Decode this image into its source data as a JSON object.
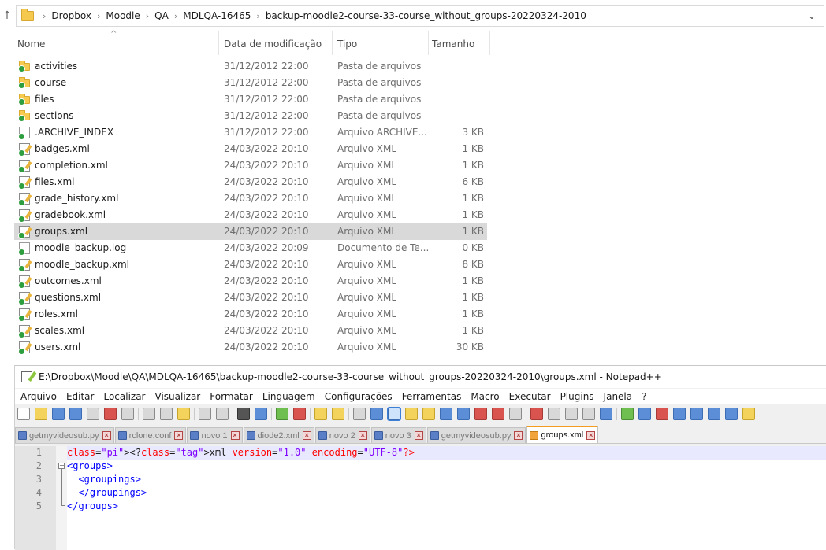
{
  "explorer": {
    "breadcrumb": [
      "Dropbox",
      "Moodle",
      "QA",
      "MDLQA-16465",
      "backup-moodle2-course-33-course_without_groups-20220324-2010"
    ],
    "columns": {
      "name": "Nome",
      "date": "Data de modificação",
      "type": "Tipo",
      "size": "Tamanho"
    },
    "files": [
      {
        "name": "activities",
        "date": "31/12/2012 22:00",
        "type": "Pasta de arquivos",
        "size": "",
        "icon": "folder-icon"
      },
      {
        "name": "course",
        "date": "31/12/2012 22:00",
        "type": "Pasta de arquivos",
        "size": "",
        "icon": "folder-icon"
      },
      {
        "name": "files",
        "date": "31/12/2012 22:00",
        "type": "Pasta de arquivos",
        "size": "",
        "icon": "folder-icon"
      },
      {
        "name": "sections",
        "date": "31/12/2012 22:00",
        "type": "Pasta de arquivos",
        "size": "",
        "icon": "folder-icon"
      },
      {
        "name": ".ARCHIVE_INDEX",
        "date": "31/12/2012 22:00",
        "type": "Arquivo ARCHIVE...",
        "size": "3 KB",
        "icon": "file-icon"
      },
      {
        "name": "badges.xml",
        "date": "24/03/2022 20:10",
        "type": "Arquivo XML",
        "size": "1 KB",
        "icon": "xml-file-icon"
      },
      {
        "name": "completion.xml",
        "date": "24/03/2022 20:10",
        "type": "Arquivo XML",
        "size": "1 KB",
        "icon": "xml-file-icon"
      },
      {
        "name": "files.xml",
        "date": "24/03/2022 20:10",
        "type": "Arquivo XML",
        "size": "6 KB",
        "icon": "xml-file-icon"
      },
      {
        "name": "grade_history.xml",
        "date": "24/03/2022 20:10",
        "type": "Arquivo XML",
        "size": "1 KB",
        "icon": "xml-file-icon"
      },
      {
        "name": "gradebook.xml",
        "date": "24/03/2022 20:10",
        "type": "Arquivo XML",
        "size": "1 KB",
        "icon": "xml-file-icon"
      },
      {
        "name": "groups.xml",
        "date": "24/03/2022 20:10",
        "type": "Arquivo XML",
        "size": "1 KB",
        "icon": "xml-file-icon",
        "selected": true
      },
      {
        "name": "moodle_backup.log",
        "date": "24/03/2022 20:09",
        "type": "Documento de Te...",
        "size": "0 KB",
        "icon": "file-icon"
      },
      {
        "name": "moodle_backup.xml",
        "date": "24/03/2022 20:10",
        "type": "Arquivo XML",
        "size": "8 KB",
        "icon": "xml-file-icon"
      },
      {
        "name": "outcomes.xml",
        "date": "24/03/2022 20:10",
        "type": "Arquivo XML",
        "size": "1 KB",
        "icon": "xml-file-icon"
      },
      {
        "name": "questions.xml",
        "date": "24/03/2022 20:10",
        "type": "Arquivo XML",
        "size": "1 KB",
        "icon": "xml-file-icon"
      },
      {
        "name": "roles.xml",
        "date": "24/03/2022 20:10",
        "type": "Arquivo XML",
        "size": "1 KB",
        "icon": "xml-file-icon"
      },
      {
        "name": "scales.xml",
        "date": "24/03/2022 20:10",
        "type": "Arquivo XML",
        "size": "1 KB",
        "icon": "xml-file-icon"
      },
      {
        "name": "users.xml",
        "date": "24/03/2022 20:10",
        "type": "Arquivo XML",
        "size": "30 KB",
        "icon": "xml-file-icon"
      }
    ]
  },
  "notepad": {
    "title": "E:\\Dropbox\\Moodle\\QA\\MDLQA-16465\\backup-moodle2-course-33-course_without_groups-20220324-2010\\groups.xml - Notepad++",
    "menu": [
      "Arquivo",
      "Editar",
      "Localizar",
      "Visualizar",
      "Formatar",
      "Linguagem",
      "Configurações",
      "Ferramentas",
      "Macro",
      "Executar",
      "Plugins",
      "Janela",
      "?"
    ],
    "tabs": [
      {
        "label": "getmyvideosub.py",
        "active": false
      },
      {
        "label": "rclone.conf",
        "active": false
      },
      {
        "label": "novo 1",
        "active": false
      },
      {
        "label": "diode2.xml",
        "active": false
      },
      {
        "label": "novo 2",
        "active": false
      },
      {
        "label": "novo 3",
        "active": false
      },
      {
        "label": "getmyvideosub.py",
        "active": false
      },
      {
        "label": "groups.xml",
        "active": true
      }
    ],
    "code_lines": [
      "<?xml version=\"1.0\" encoding=\"UTF-8\"?>",
      "<groups>",
      "  <groupings>",
      "  </groupings>",
      "</groups>"
    ],
    "line_numbers": [
      "1",
      "2",
      "3",
      "4",
      "5"
    ]
  }
}
